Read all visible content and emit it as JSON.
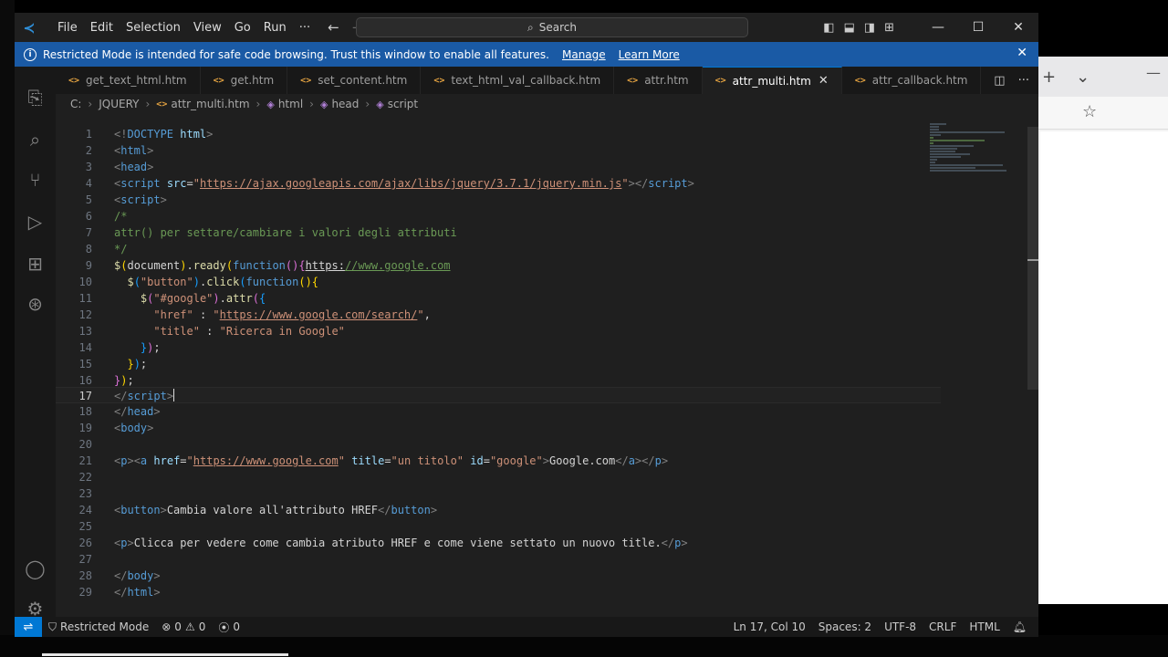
{
  "titlebar": {
    "menu": [
      "File",
      "Edit",
      "Selection",
      "View",
      "Go",
      "Run",
      "···"
    ],
    "search_placeholder": "Search"
  },
  "banner": {
    "message": "Restricted Mode is intended for safe code browsing. Trust this window to enable all features.",
    "manage": "Manage",
    "learn_more": "Learn More"
  },
  "tabs": [
    {
      "label": "get_text_html.htm",
      "active": false
    },
    {
      "label": "get.htm",
      "active": false
    },
    {
      "label": "set_content.htm",
      "active": false
    },
    {
      "label": "text_html_val_callback.htm",
      "active": false
    },
    {
      "label": "attr.htm",
      "active": false
    },
    {
      "label": "attr_multi.htm",
      "active": true
    },
    {
      "label": "attr_callback.htm",
      "active": false
    }
  ],
  "breadcrumb": [
    "C:",
    "JQUERY",
    "attr_multi.htm",
    "html",
    "head",
    "script"
  ],
  "editor": {
    "current_line": 17,
    "line_numbers": [
      "1",
      "2",
      "3",
      "4",
      "5",
      "6",
      "7",
      "8",
      "9",
      "10",
      "11",
      "12",
      "13",
      "14",
      "15",
      "16",
      "17",
      "18",
      "19",
      "20",
      "21",
      "22",
      "23",
      "24",
      "25",
      "26",
      "27",
      "28",
      "29"
    ],
    "code": {
      "l1_a": "<!",
      "l1_b": "DOCTYPE",
      "l1_c": " html",
      "l1_d": ">",
      "l2": "html",
      "l3": "head",
      "l4_tag": "script",
      "l4_attr": "src",
      "l4_url": "https://ajax.googleapis.com/ajax/libs/jquery/3.7.1/jquery.min.js",
      "l5": "script",
      "l6": "/*",
      "l7": "attr() per settare/cambiare i valori degli attributi",
      "l8": "*/",
      "l9_a": "$",
      "l9_b": "document",
      "l9_c": ".",
      "l9_d": "ready",
      "l9_e": "function",
      "l9_f": "https:",
      "l9_g": "//www.google.com",
      "l10_a": "\"button\"",
      "l10_b": "click",
      "l10_c": "function",
      "l11_a": "\"#google\"",
      "l11_b": "attr",
      "l12_a": "\"href\"",
      "l12_b": "https://www.google.com/search/",
      "l13_a": "\"title\"",
      "l13_b": "\"Ricerca in Google\"",
      "l17": "script",
      "l18": "head",
      "l19": "body",
      "l21_p": "p",
      "l21_a": "a",
      "l21_href": "href",
      "l21_url": "https://www.google.com",
      "l21_title": "title",
      "l21_title_val": "\"un titolo\"",
      "l21_id": "id",
      "l21_id_val": "\"google\"",
      "l21_text": "Google.com",
      "l24_tag": "button",
      "l24_text": "Cambia valore all'attributo HREF",
      "l26_tag": "p",
      "l26_text": "Clicca per vedere come cambia atributo HREF e come viene settato un nuovo title.",
      "l28": "body",
      "l29": "html"
    }
  },
  "statusbar": {
    "restricted": "Restricted Mode",
    "errors": "0",
    "warnings": "0",
    "ports": "0",
    "position": "Ln 17, Col 10",
    "spaces": "Spaces: 2",
    "encoding": "UTF-8",
    "eol": "CRLF",
    "language": "HTML"
  },
  "colors": {
    "accent": "#0078d4",
    "banner": "#1a5aa5",
    "editor_bg": "#1f1f1f"
  }
}
